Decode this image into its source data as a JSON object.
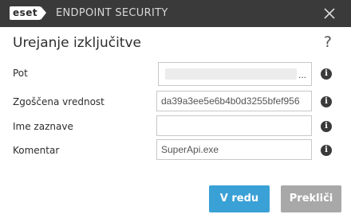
{
  "window": {
    "brand_logo": "eset",
    "product_name": "ENDPOINT SECURITY",
    "close_icon": "close-icon"
  },
  "dialog": {
    "title": "Urejanje izključitve",
    "help_label": "?"
  },
  "fields": {
    "path": {
      "label": "Pot",
      "value": "",
      "browse_label": "..."
    },
    "hash": {
      "label": "Zgoščena vrednost",
      "value": "da39a3ee5e6b4b0d3255bfef956"
    },
    "name": {
      "label": "Ime zaznave",
      "value": ""
    },
    "comment": {
      "label": "Komentar",
      "value": "SuperApi.exe"
    }
  },
  "info_icon_glyph": "i",
  "buttons": {
    "ok": "V redu",
    "cancel": "Prekliči"
  },
  "colors": {
    "titlebar": "#3a3a3a",
    "primary_button": "#3aa1d6",
    "secondary_button": "#a8a8a8"
  }
}
